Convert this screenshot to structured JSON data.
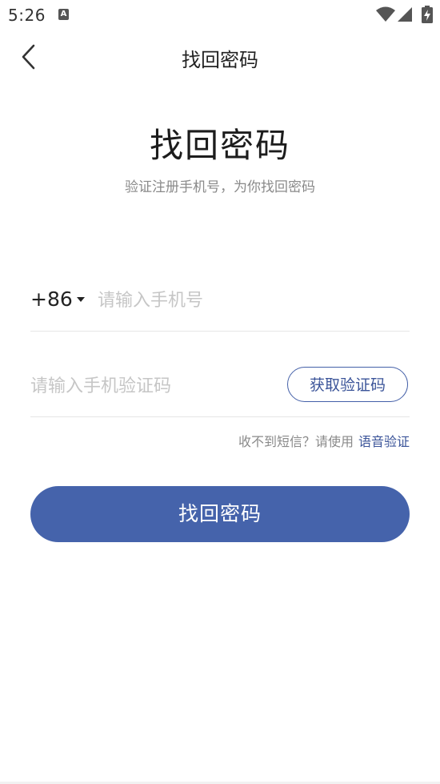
{
  "status_bar": {
    "time": "5:26",
    "notification_icon": "text-a-icon",
    "notification_glyph": "A"
  },
  "app_bar": {
    "title": "找回密码",
    "back_icon": "chevron-left-icon"
  },
  "header": {
    "heading": "找回密码",
    "subtitle": "验证注册手机号，为你找回密码"
  },
  "form": {
    "country_code": "+86",
    "phone_placeholder": "请输入手机号",
    "phone_value": "",
    "code_placeholder": "请输入手机验证码",
    "code_value": "",
    "get_code_label": "获取验证码",
    "voice_hint_text": "收不到短信？请使用",
    "voice_link_label": "语音验证",
    "submit_label": "找回密码"
  },
  "colors": {
    "accent": "#4563ab",
    "link": "#3b5499",
    "placeholder": "#c6c6c6",
    "hint": "#8a8a8a"
  }
}
